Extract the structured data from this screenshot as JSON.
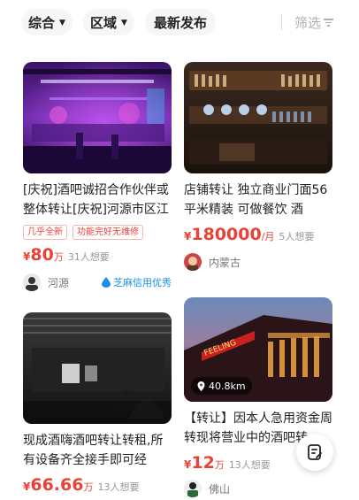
{
  "filters": {
    "sort_label": "综合",
    "area_label": "区域",
    "latest_label": "最新发布",
    "filter_label": "筛选"
  },
  "cards": [
    {
      "title": "[庆祝]酒吧诚招合作伙伴或整体转让[庆祝]河源市区江",
      "tags": [
        "几乎全新",
        "功能完好无维修"
      ],
      "price_symbol": "¥",
      "price_value": "80",
      "price_unit": "万",
      "wants": "31人想要",
      "location": "河源",
      "credit_label": "芝麻信用优秀"
    },
    {
      "title": "店铺转让 独立商业门面56平米精装 可做餐饮 酒",
      "price_symbol": "¥",
      "price_value": "180000",
      "price_unit": "/月",
      "wants": "5人想要",
      "location": "内蒙古"
    },
    {
      "title": "现成酒嗨酒吧转让转租,所有设备齐全接手即可经",
      "price_symbol": "¥",
      "price_value": "66.66",
      "price_unit": "万",
      "wants": "13人想要"
    },
    {
      "title": "【转让】因本人急用资金周转现将营业中的酒吧转",
      "distance": "40.8km",
      "sign_text": "FEELING",
      "price_symbol": "¥",
      "price_value": "12",
      "price_unit": "万",
      "wants": "13人想要",
      "location": "佛山"
    }
  ],
  "icons": {
    "sort_caret": "caret-down-icon",
    "filter": "filter-icon",
    "credit": "zhima-credit-icon",
    "distance": "location-pin-icon",
    "float": "publish-edit-icon"
  },
  "colors": {
    "price": "#e94236",
    "credit": "#1a8fe8",
    "chip_bg": "#f6f6f6"
  }
}
